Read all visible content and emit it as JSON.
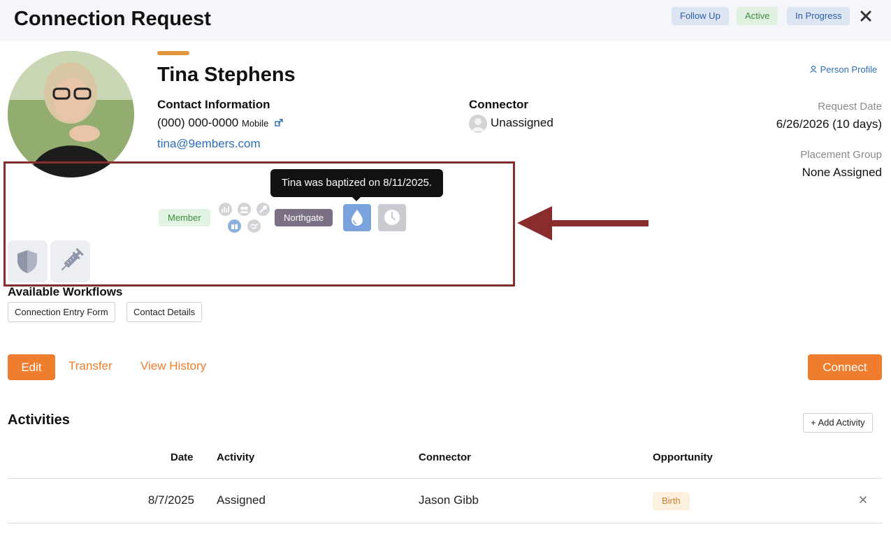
{
  "header": {
    "title": "Connection Request",
    "badges": [
      "Follow Up",
      "Active",
      "In Progress"
    ]
  },
  "person": {
    "name": "Tina Stephens",
    "contact_label": "Contact Information",
    "phone": "(000) 000-0000",
    "phone_type": "Mobile",
    "email": "tina@9embers.com",
    "connector_label": "Connector",
    "connector_value": "Unassigned",
    "profile_link": "Person Profile",
    "request_date_label": "Request Date",
    "request_date_value": "6/26/2026 (10 days)",
    "placement_label": "Placement Group",
    "placement_value": "None Assigned"
  },
  "badges": {
    "member": "Member",
    "campus": "Northgate",
    "tooltip": "Tina was baptized on 8/11/2025."
  },
  "workflows": {
    "title": "Available Workflows",
    "buttons": [
      "Connection Entry Form",
      "Contact Details"
    ]
  },
  "actions": {
    "edit": "Edit",
    "transfer": "Transfer",
    "history": "View History",
    "connect": "Connect"
  },
  "activities": {
    "title": "Activities",
    "add_label": "+ Add Activity",
    "columns": [
      "Date",
      "Activity",
      "Connector",
      "Opportunity"
    ],
    "rows": [
      {
        "date": "8/7/2025",
        "activity": "Assigned",
        "connector": "Jason Gibb",
        "opportunity": "Birth"
      }
    ]
  },
  "colors": {
    "accent": "#ee7e2d",
    "link": "#2c6fb7",
    "highlight_border": "#8a2c2e"
  }
}
